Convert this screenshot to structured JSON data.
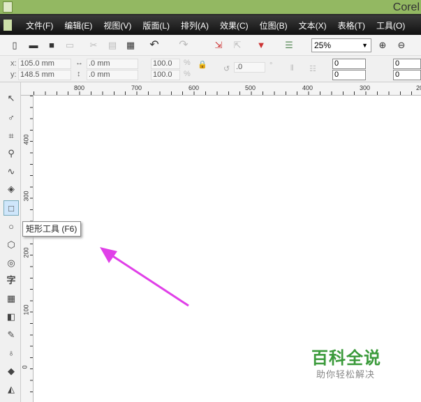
{
  "app": {
    "title": "Corel"
  },
  "menu": [
    "文件(F)",
    "编辑(E)",
    "视图(V)",
    "版面(L)",
    "排列(A)",
    "效果(C)",
    "位图(B)",
    "文本(X)",
    "表格(T)",
    "工具(O)"
  ],
  "toolbar": {
    "zoom": "25%"
  },
  "propbar": {
    "x_label": "x:",
    "x": "105.0 mm",
    "y_label": "y:",
    "y": "148.5 mm",
    "w": ".0 mm",
    "h": ".0 mm",
    "sx": "100.0",
    "sy": "100.0",
    "pct": "%",
    "angle": ".0",
    "deg": "°",
    "c1": "0",
    "c2": "0",
    "c3": "0",
    "c4": "0"
  },
  "ruler_top": [
    "800",
    "700",
    "600",
    "500",
    "400",
    "300",
    "20"
  ],
  "ruler_left": [
    "400",
    "300",
    "200",
    "100",
    "0"
  ],
  "tooltip": "矩形工具 (F6)",
  "watermark": {
    "title": "百科全说",
    "subtitle": "助你轻松解决"
  },
  "colors": {
    "arrow": "#e040e8",
    "title_bar": "#93b862"
  }
}
